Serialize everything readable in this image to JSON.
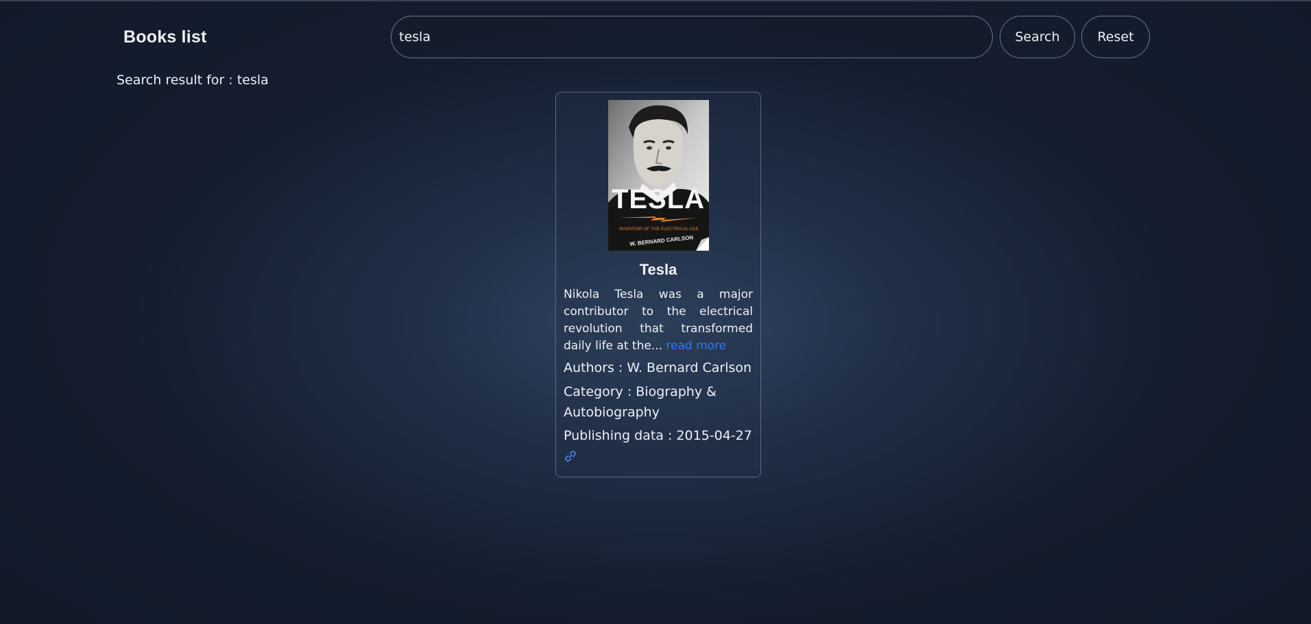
{
  "header": {
    "brand": "Books list",
    "search_value": "tesla",
    "search_button": "Search",
    "reset_button": "Reset"
  },
  "results": {
    "label": "Search result for : tesla"
  },
  "book": {
    "cover_title": "TESLA",
    "cover_subtitle": "INVENTOR OF THE ELECTRICAL AGE",
    "cover_author": "W. BERNARD CARLSON",
    "title": "Tesla",
    "description": "Nikola Tesla was a major contributor to the electrical revolution that transformed daily life at the...",
    "read_more": "read more",
    "authors_line": "Authors : W. Bernard Carlson",
    "category_line": "Category : Biography & Autobiography",
    "published_line": "Publishing data : 2015-04-27",
    "link_icon": "link-icon"
  },
  "colors": {
    "background": "#121a2a",
    "accent_link": "#2f74ff",
    "border": "#6b7a90"
  }
}
